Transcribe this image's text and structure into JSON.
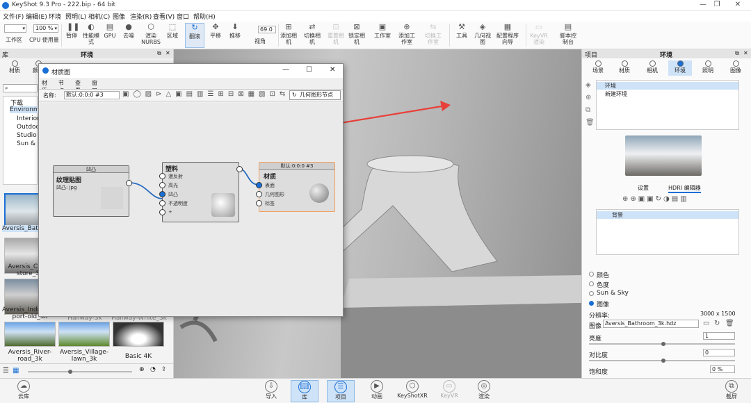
{
  "window": {
    "title": "KeyShot 9.3 Pro - 222.bip - 64 bit",
    "min": "—",
    "max": "❐",
    "close": "✕"
  },
  "menu": [
    "文件(F)",
    "编辑(E)",
    "环境",
    "照明(L)",
    "相机(C)",
    "图像",
    "渲染(R)",
    "查看(V)",
    "窗口",
    "帮助(H)"
  ],
  "toolbar": {
    "zoom": "100 %",
    "fov": "69.0",
    "items": [
      "工作区",
      "CPU 使用量",
      "暂停",
      "性能模式",
      "GPU",
      "去噪",
      "渲染NURBS",
      "区域",
      "翻滚",
      "平移",
      "推移",
      "视角",
      "添加相机",
      "切换相机",
      "重置相机",
      "锁定相机",
      "工作室",
      "添加工作室",
      "切换工作室",
      "工具",
      "几何视图",
      "配置程序向导",
      "KeyVR 渲染",
      "脚本控制台"
    ]
  },
  "library": {
    "title": "库",
    "panel_title": "环境",
    "tabs": [
      "材质",
      "颜色"
    ],
    "tree": [
      "下载",
      "Environments",
      "Interior",
      "Outdoor",
      "Studio",
      "Sun & Sky"
    ],
    "thumbs": [
      "Aversis_Bathroom",
      "Aversis_Cloth-store_3k",
      "Aversis_Industrial-port-old_3k",
      "Hallway-3k",
      "Hallway-White_3k",
      "Aversis_River-road_3k",
      "Aversis_Village-lawn_3k",
      "Basic 4K"
    ]
  },
  "material_graph": {
    "title": "材质图",
    "menu": [
      "材质",
      "节点",
      "查看",
      "窗口"
    ],
    "name_label": "名称:",
    "name_value": "默认:0:0:0 #3",
    "geometry_button": "几何图形节点",
    "nodes": {
      "texture": {
        "header": "凹凸",
        "title": "纹理贴图",
        "sub": "凹凸: jpg"
      },
      "plastic": {
        "header": "",
        "title": "塑料",
        "ports": [
          "漫反射",
          "高光",
          "凹凸",
          "不透明度",
          "+"
        ]
      },
      "material": {
        "header": "默认:0:0:0 #3",
        "title": "材质",
        "ports": [
          "表面",
          "几何图形",
          "标签"
        ]
      }
    }
  },
  "project": {
    "title": "项目",
    "panel_title": "环境",
    "tabs": [
      "场景",
      "材质",
      "相机",
      "环境",
      "照明",
      "图像"
    ],
    "env_list": [
      "环境",
      "新建环境"
    ],
    "subtabs": [
      "设置",
      "HDRI 编辑器"
    ],
    "layer": "背景",
    "bg_options": [
      "颜色",
      "色度",
      "Sun & Sky",
      "图像"
    ],
    "resolution_label": "分辨率:",
    "resolution_value": "3000 x 1500",
    "image_label": "图像",
    "image_value": "Aversis_Bathroom_3k.hdz",
    "brightness_label": "亮度",
    "brightness_value": "1",
    "contrast_label": "对比度",
    "contrast_value": "0",
    "saturation_label": "饱和度",
    "saturation_value": "0 %"
  },
  "bottom": {
    "cloud": "云库",
    "items": [
      "导入",
      "库",
      "项目",
      "动画",
      "KeyShotXR",
      "KeyVR",
      "渲染"
    ],
    "screenshot": "截屏"
  },
  "colors": {
    "accent": "#1a6fd6",
    "arrow": "#e8403a",
    "node_highlight": "#f0a060"
  }
}
